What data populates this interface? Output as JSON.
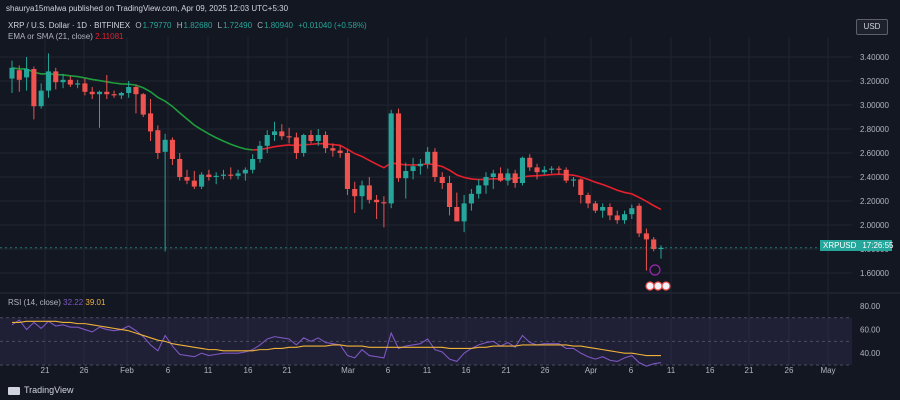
{
  "attribution": "shaurya15malwa published on TradingView.com, Apr 09, 2025 12:03 UTC+5:30",
  "symbol": {
    "name": "XRP / U.S. Dollar · 1D · BITFINEX",
    "o_label": "O",
    "o": "1.79770",
    "h_label": "H",
    "h": "1.82680",
    "l_label": "L",
    "l": "1.72490",
    "c_label": "C",
    "c": "1.80940",
    "change": "+0.01040 (+0.58%)"
  },
  "ema": {
    "label": "EMA or SMA (21, close)",
    "value": "2.11081"
  },
  "rsi": {
    "label": "RSI (14, close)",
    "value1": "32.22",
    "value2": "39.01"
  },
  "currency_button": "USD",
  "price_tag": {
    "symbol": "XRPUSD",
    "time": "17:26:55"
  },
  "footer_logo": "TradingView",
  "colors": {
    "bg": "#131722",
    "up": "#26a69a",
    "down": "#ef5350",
    "ema_red": "#e5202c",
    "ema_green": "#1f9d3d",
    "rsi_line": "#7e57c2",
    "rsi_ma": "#f0b33a",
    "grid": "#1f2430"
  },
  "chart_data": [
    {
      "type": "candlestick",
      "title": "XRP / U.S. Dollar · 1D · BITFINEX",
      "y_ticks": [
        "3.40000",
        "3.20000",
        "3.00000",
        "2.80000",
        "2.60000",
        "2.40000",
        "2.20000",
        "2.00000",
        "1.80000",
        "1.60000"
      ],
      "ylim": [
        1.5,
        3.5
      ],
      "x_ticks": [
        "21",
        "26",
        "Feb",
        "6",
        "11",
        "16",
        "21",
        "Mar",
        "6",
        "11",
        "16",
        "21",
        "26",
        "Apr",
        "6",
        "11",
        "16",
        "21",
        "26",
        "May"
      ],
      "candles": [
        {
          "o": 3.22,
          "h": 3.37,
          "l": 3.1,
          "c": 3.31
        },
        {
          "o": 3.29,
          "h": 3.33,
          "l": 3.11,
          "c": 3.21
        },
        {
          "o": 3.23,
          "h": 3.4,
          "l": 3.12,
          "c": 3.3
        },
        {
          "o": 3.3,
          "h": 3.32,
          "l": 2.88,
          "c": 2.99
        },
        {
          "o": 2.99,
          "h": 3.18,
          "l": 2.97,
          "c": 3.12
        },
        {
          "o": 3.12,
          "h": 3.43,
          "l": 3.06,
          "c": 3.28
        },
        {
          "o": 3.28,
          "h": 3.31,
          "l": 3.13,
          "c": 3.19
        },
        {
          "o": 3.19,
          "h": 3.26,
          "l": 3.14,
          "c": 3.21
        },
        {
          "o": 3.21,
          "h": 3.24,
          "l": 3.15,
          "c": 3.17
        },
        {
          "o": 3.17,
          "h": 3.21,
          "l": 3.14,
          "c": 3.18
        },
        {
          "o": 3.18,
          "h": 3.22,
          "l": 3.08,
          "c": 3.11
        },
        {
          "o": 3.11,
          "h": 3.15,
          "l": 3.05,
          "c": 3.09
        },
        {
          "o": 3.09,
          "h": 3.12,
          "l": 2.81,
          "c": 3.11
        },
        {
          "o": 3.11,
          "h": 3.25,
          "l": 3.05,
          "c": 3.09
        },
        {
          "o": 3.09,
          "h": 3.12,
          "l": 3.06,
          "c": 3.08
        },
        {
          "o": 3.08,
          "h": 3.11,
          "l": 3.05,
          "c": 3.1
        },
        {
          "o": 3.1,
          "h": 3.2,
          "l": 3.06,
          "c": 3.15
        },
        {
          "o": 3.15,
          "h": 3.17,
          "l": 2.93,
          "c": 3.09
        },
        {
          "o": 3.09,
          "h": 3.1,
          "l": 2.9,
          "c": 2.92
        },
        {
          "o": 2.93,
          "h": 3.05,
          "l": 2.7,
          "c": 2.78
        },
        {
          "o": 2.79,
          "h": 2.83,
          "l": 2.55,
          "c": 2.6
        },
        {
          "o": 2.61,
          "h": 2.76,
          "l": 1.78,
          "c": 2.71
        },
        {
          "o": 2.71,
          "h": 2.73,
          "l": 2.5,
          "c": 2.55
        },
        {
          "o": 2.55,
          "h": 2.6,
          "l": 2.37,
          "c": 2.4
        },
        {
          "o": 2.4,
          "h": 2.46,
          "l": 2.34,
          "c": 2.37
        },
        {
          "o": 2.37,
          "h": 2.45,
          "l": 2.3,
          "c": 2.32
        },
        {
          "o": 2.32,
          "h": 2.44,
          "l": 2.3,
          "c": 2.42
        },
        {
          "o": 2.42,
          "h": 2.46,
          "l": 2.37,
          "c": 2.4
        },
        {
          "o": 2.4,
          "h": 2.44,
          "l": 2.34,
          "c": 2.41
        },
        {
          "o": 2.41,
          "h": 2.46,
          "l": 2.38,
          "c": 2.42
        },
        {
          "o": 2.42,
          "h": 2.48,
          "l": 2.38,
          "c": 2.41
        },
        {
          "o": 2.41,
          "h": 2.46,
          "l": 2.38,
          "c": 2.43
        },
        {
          "o": 2.43,
          "h": 2.48,
          "l": 2.37,
          "c": 2.46
        },
        {
          "o": 2.46,
          "h": 2.59,
          "l": 2.43,
          "c": 2.55
        },
        {
          "o": 2.55,
          "h": 2.7,
          "l": 2.52,
          "c": 2.66
        },
        {
          "o": 2.66,
          "h": 2.79,
          "l": 2.6,
          "c": 2.75
        },
        {
          "o": 2.75,
          "h": 2.86,
          "l": 2.7,
          "c": 2.78
        },
        {
          "o": 2.78,
          "h": 2.84,
          "l": 2.71,
          "c": 2.74
        },
        {
          "o": 2.74,
          "h": 2.81,
          "l": 2.68,
          "c": 2.73
        },
        {
          "o": 2.73,
          "h": 2.77,
          "l": 2.55,
          "c": 2.6
        },
        {
          "o": 2.6,
          "h": 2.76,
          "l": 2.57,
          "c": 2.75
        },
        {
          "o": 2.75,
          "h": 2.79,
          "l": 2.68,
          "c": 2.7
        },
        {
          "o": 2.7,
          "h": 2.8,
          "l": 2.66,
          "c": 2.75
        },
        {
          "o": 2.75,
          "h": 2.78,
          "l": 2.6,
          "c": 2.64
        },
        {
          "o": 2.64,
          "h": 2.68,
          "l": 2.57,
          "c": 2.62
        },
        {
          "o": 2.62,
          "h": 2.66,
          "l": 2.56,
          "c": 2.6
        },
        {
          "o": 2.6,
          "h": 2.63,
          "l": 2.25,
          "c": 2.3
        },
        {
          "o": 2.3,
          "h": 2.36,
          "l": 2.1,
          "c": 2.24
        },
        {
          "o": 2.24,
          "h": 2.37,
          "l": 2.13,
          "c": 2.33
        },
        {
          "o": 2.33,
          "h": 2.4,
          "l": 2.18,
          "c": 2.21
        },
        {
          "o": 2.21,
          "h": 2.25,
          "l": 2.05,
          "c": 2.19
        },
        {
          "o": 2.19,
          "h": 2.24,
          "l": 1.98,
          "c": 2.18
        },
        {
          "o": 2.18,
          "h": 2.96,
          "l": 2.14,
          "c": 2.93
        },
        {
          "o": 2.93,
          "h": 2.97,
          "l": 2.36,
          "c": 2.39
        },
        {
          "o": 2.39,
          "h": 2.52,
          "l": 2.22,
          "c": 2.45
        },
        {
          "o": 2.45,
          "h": 2.56,
          "l": 2.38,
          "c": 2.49
        },
        {
          "o": 2.49,
          "h": 2.55,
          "l": 2.42,
          "c": 2.51
        },
        {
          "o": 2.51,
          "h": 2.65,
          "l": 2.47,
          "c": 2.61
        },
        {
          "o": 2.61,
          "h": 2.64,
          "l": 2.36,
          "c": 2.4
        },
        {
          "o": 2.4,
          "h": 2.44,
          "l": 2.3,
          "c": 2.35
        },
        {
          "o": 2.35,
          "h": 2.41,
          "l": 2.08,
          "c": 2.15
        },
        {
          "o": 2.15,
          "h": 2.27,
          "l": 2.04,
          "c": 2.03
        },
        {
          "o": 2.03,
          "h": 2.25,
          "l": 1.94,
          "c": 2.18
        },
        {
          "o": 2.18,
          "h": 2.3,
          "l": 2.12,
          "c": 2.26
        },
        {
          "o": 2.26,
          "h": 2.38,
          "l": 2.22,
          "c": 2.33
        },
        {
          "o": 2.33,
          "h": 2.44,
          "l": 2.26,
          "c": 2.4
        },
        {
          "o": 2.4,
          "h": 2.46,
          "l": 2.3,
          "c": 2.43
        },
        {
          "o": 2.43,
          "h": 2.48,
          "l": 2.36,
          "c": 2.37
        },
        {
          "o": 2.37,
          "h": 2.47,
          "l": 2.33,
          "c": 2.43
        },
        {
          "o": 2.43,
          "h": 2.46,
          "l": 2.31,
          "c": 2.35
        },
        {
          "o": 2.35,
          "h": 2.57,
          "l": 2.33,
          "c": 2.56
        },
        {
          "o": 2.56,
          "h": 2.59,
          "l": 2.45,
          "c": 2.48
        },
        {
          "o": 2.48,
          "h": 2.51,
          "l": 2.38,
          "c": 2.44
        },
        {
          "o": 2.44,
          "h": 2.49,
          "l": 2.42,
          "c": 2.46
        },
        {
          "o": 2.46,
          "h": 2.49,
          "l": 2.43,
          "c": 2.47
        },
        {
          "o": 2.47,
          "h": 2.49,
          "l": 2.42,
          "c": 2.46
        },
        {
          "o": 2.46,
          "h": 2.48,
          "l": 2.35,
          "c": 2.37
        },
        {
          "o": 2.37,
          "h": 2.4,
          "l": 2.32,
          "c": 2.38
        },
        {
          "o": 2.38,
          "h": 2.39,
          "l": 2.18,
          "c": 2.25
        },
        {
          "o": 2.25,
          "h": 2.27,
          "l": 2.14,
          "c": 2.18
        },
        {
          "o": 2.18,
          "h": 2.2,
          "l": 2.1,
          "c": 2.12
        },
        {
          "o": 2.12,
          "h": 2.18,
          "l": 2.06,
          "c": 2.15
        },
        {
          "o": 2.15,
          "h": 2.18,
          "l": 2.04,
          "c": 2.08
        },
        {
          "o": 2.08,
          "h": 2.12,
          "l": 2.01,
          "c": 2.04
        },
        {
          "o": 2.04,
          "h": 2.12,
          "l": 2.01,
          "c": 2.09
        },
        {
          "o": 2.09,
          "h": 2.17,
          "l": 2.05,
          "c": 2.14
        },
        {
          "o": 2.16,
          "h": 2.18,
          "l": 1.9,
          "c": 1.93
        },
        {
          "o": 1.93,
          "h": 1.97,
          "l": 1.62,
          "c": 1.88
        },
        {
          "o": 1.88,
          "h": 1.9,
          "l": 1.78,
          "c": 1.8
        },
        {
          "o": 1.8,
          "h": 1.83,
          "l": 1.72,
          "c": 1.81
        }
      ],
      "current_price_label": "XRPUSD"
    },
    {
      "type": "line",
      "title": "RSI (14, close)",
      "y_ticks": [
        "80.00",
        "60.00",
        "40.00"
      ],
      "ylim": [
        30,
        85
      ],
      "series": [
        {
          "name": "RSI (14, close)",
          "values": [
            64,
            68,
            60,
            66,
            61,
            67,
            63,
            64,
            62,
            62,
            60,
            58,
            62,
            60,
            59,
            60,
            63,
            59,
            54,
            47,
            42,
            55,
            46,
            39,
            38,
            37,
            40,
            38,
            39,
            40,
            40,
            40,
            41,
            43,
            47,
            52,
            54,
            53,
            52,
            47,
            53,
            50,
            53,
            49,
            48,
            47,
            38,
            36,
            43,
            38,
            37,
            36,
            57,
            44,
            46,
            47,
            48,
            52,
            43,
            41,
            35,
            33,
            40,
            44,
            47,
            49,
            50,
            46,
            49,
            45,
            55,
            49,
            47,
            48,
            48,
            48,
            44,
            44,
            40,
            37,
            35,
            37,
            34,
            33,
            36,
            38,
            32,
            29,
            31,
            32
          ]
        },
        {
          "name": "MA",
          "values": [
            66,
            66,
            67,
            67,
            67,
            67,
            67,
            66,
            66,
            65,
            65,
            64,
            63,
            62,
            61,
            60,
            59,
            57,
            55,
            53,
            51,
            50,
            48,
            47,
            46,
            45,
            44,
            43,
            43,
            42,
            42,
            42,
            42,
            42,
            43,
            43,
            44,
            44,
            45,
            45,
            46,
            46,
            46,
            46,
            47,
            47,
            46,
            46,
            46,
            45,
            45,
            45,
            45,
            45,
            45,
            45,
            45,
            45,
            45,
            45,
            44,
            44,
            44,
            44,
            45,
            45,
            46,
            46,
            46,
            46,
            47,
            47,
            47,
            47,
            47,
            47,
            47,
            46,
            46,
            45,
            44,
            43,
            42,
            41,
            40,
            40,
            39,
            38,
            38,
            38
          ]
        }
      ]
    }
  ]
}
